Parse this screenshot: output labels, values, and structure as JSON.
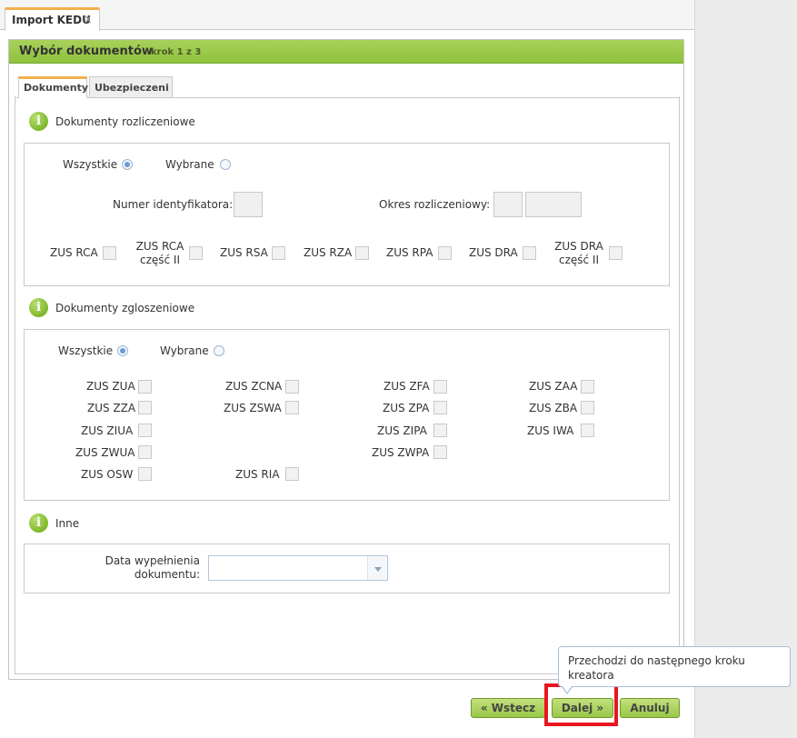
{
  "app_tab": {
    "label": "Import KEDU",
    "close": "x"
  },
  "window": {
    "title": "Wybór dokumentów",
    "step": "krok 1 z 3"
  },
  "tabs": [
    {
      "label": "Dokumenty",
      "active": true
    },
    {
      "label": "Ubezpieczeni",
      "active": false
    }
  ],
  "sections": {
    "rozliczeniowe": {
      "title": "Dokumenty rozliczeniowe",
      "radio_all": "Wszystkie",
      "radio_selected": "Wybrane",
      "selected": "Wszystkie",
      "numer_label": "Numer identyfikatora:",
      "okres_label": "Okres rozliczeniowy:",
      "docs": [
        {
          "line1": "ZUS RCA",
          "line2": ""
        },
        {
          "line1": "ZUS RCA",
          "line2": "część II"
        },
        {
          "line1": "ZUS RSA",
          "line2": ""
        },
        {
          "line1": "ZUS RZA",
          "line2": ""
        },
        {
          "line1": "ZUS RPA",
          "line2": ""
        },
        {
          "line1": "ZUS DRA",
          "line2": ""
        },
        {
          "line1": "ZUS DRA",
          "line2": "część II"
        }
      ]
    },
    "zgloszeniowe": {
      "title": "Dokumenty zgloszeniowe",
      "radio_all": "Wszystkie",
      "radio_selected": "Wybrane",
      "selected": "Wszystkie",
      "col1": [
        "ZUS ZUA",
        "ZUS ZZA",
        "ZUS ZIUA",
        "ZUS ZWUA",
        "ZUS OSW"
      ],
      "col2": [
        "ZUS ZCNA",
        "ZUS ZSWA",
        "ZUS RIA"
      ],
      "col3": [
        "ZUS ZFA",
        "ZUS ZPA",
        "ZUS ZIPA",
        "ZUS ZWPA"
      ],
      "col4": [
        "ZUS ZAA",
        "ZUS ZBA",
        "ZUS IWA"
      ]
    },
    "inne": {
      "title": "Inne",
      "date_label_line1": "Data wypełnienia",
      "date_label_line2": "dokumentu:",
      "date_value": ""
    }
  },
  "buttons": {
    "back": "« Wstecz",
    "next": "Dalej »",
    "cancel": "Anuluj"
  },
  "tooltip": {
    "text": "Przechodzi do następnego kroku kreatora"
  },
  "icons": {
    "info": "info-icon",
    "close": "close-icon",
    "dropdown": "chevron-down-icon"
  }
}
